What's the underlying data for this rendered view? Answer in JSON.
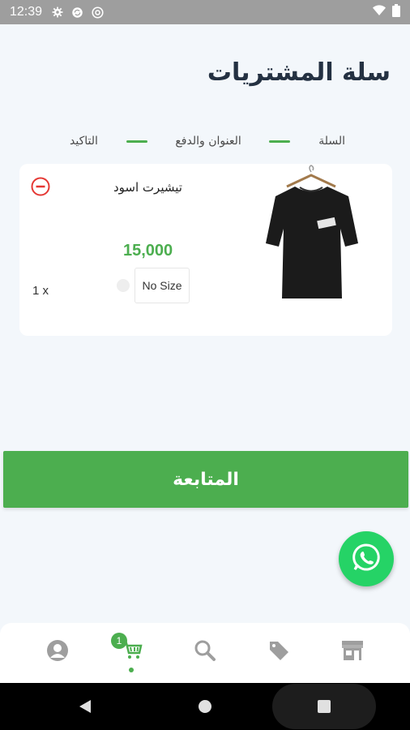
{
  "status_bar": {
    "time": "12:39",
    "left_icons": [
      "gear-icon",
      "sync-icon",
      "at-sign-icon"
    ],
    "right_icons": [
      "wifi-icon",
      "battery-icon"
    ]
  },
  "page": {
    "title": "سلة المشتريات"
  },
  "stepper": {
    "steps": [
      "السلة",
      "العنوان والدفع",
      "التاكيد"
    ],
    "accent": "#4cae4f"
  },
  "cart": {
    "items": [
      {
        "name": "تيشيرت اسود",
        "price": "15,000",
        "size": "No Size",
        "quantity": "1 x",
        "image": "black-tshirt-image"
      }
    ]
  },
  "actions": {
    "continue_label": "المتابعة",
    "whatsapp_icon": "whatsapp-icon"
  },
  "bottom_nav": {
    "items": [
      "profile-icon",
      "cart-icon",
      "search-icon",
      "tag-icon",
      "store-icon"
    ],
    "active": "cart-icon",
    "cart_badge": "1"
  },
  "colors": {
    "accent": "#4cae4f",
    "remove": "#e53935",
    "title": "#243142",
    "whatsapp": "#25d366"
  }
}
